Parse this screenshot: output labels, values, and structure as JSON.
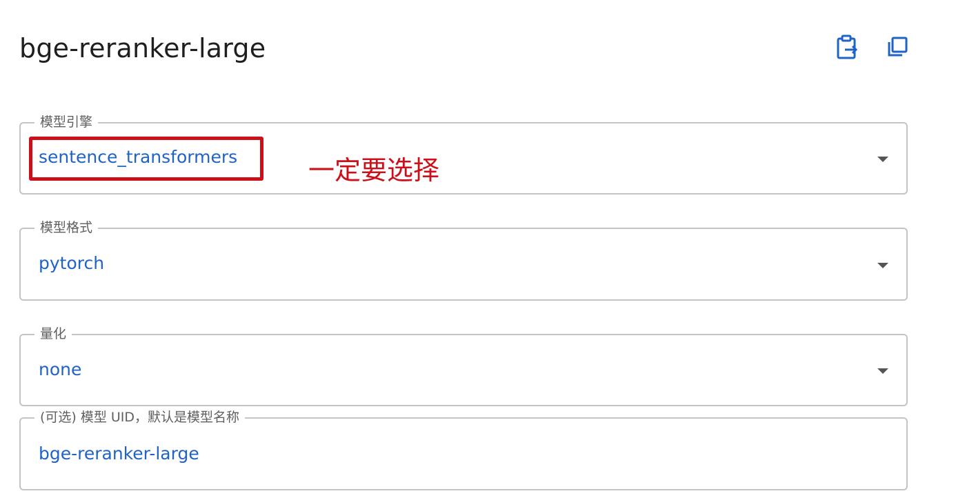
{
  "header": {
    "title": "bge-reranker-large",
    "icons": [
      "clipboard-export-icon",
      "copy-icon"
    ]
  },
  "form": {
    "fields": [
      {
        "label": "模型引擎",
        "value": "sentence_transformers",
        "type": "select"
      },
      {
        "label": "模型格式",
        "value": "pytorch",
        "type": "select"
      },
      {
        "label": "量化",
        "value": "none",
        "type": "select"
      },
      {
        "label": "(可选) 模型 UID，默认是模型名称",
        "value": "bge-reranker-large",
        "type": "text"
      }
    ]
  },
  "annotation": {
    "text": "一定要选择",
    "color": "#cc1019"
  },
  "colors": {
    "accent": "#1f63c6",
    "border": "#c4c4c4"
  }
}
